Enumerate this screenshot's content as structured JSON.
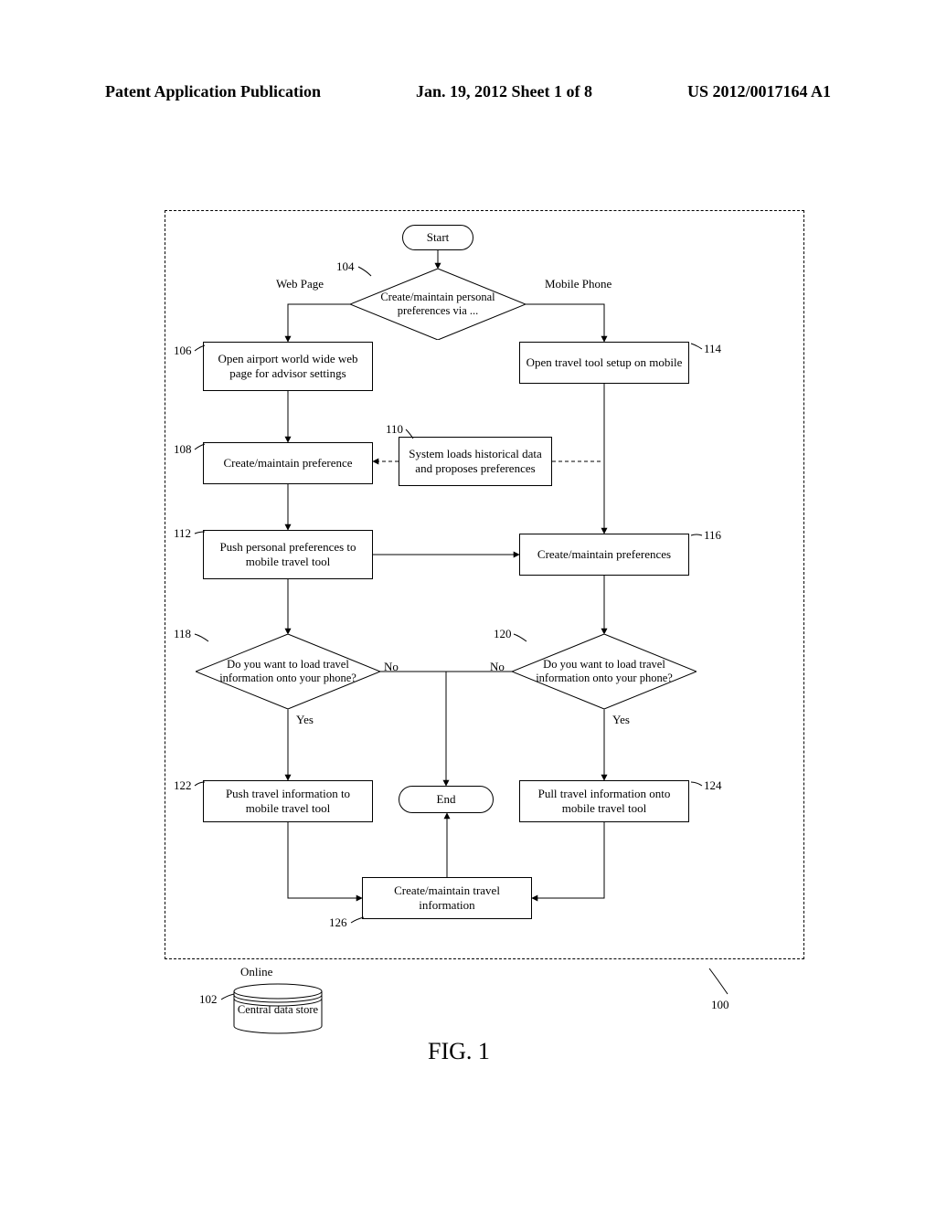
{
  "header": {
    "left": "Patent Application Publication",
    "center": "Jan. 19, 2012  Sheet 1 of 8",
    "right": "US 2012/0017164 A1"
  },
  "figure_label": "FIG. 1",
  "terminators": {
    "start": "Start",
    "end": "End"
  },
  "branch_labels": {
    "web": "Web Page",
    "mobile": "Mobile Phone",
    "yes": "Yes",
    "no": "No",
    "online": "Online"
  },
  "decisions": {
    "d104": "Create/maintain personal preferences via ...",
    "d118": "Do you want to load travel information onto your phone?",
    "d120": "Do you want to load travel information onto your phone?"
  },
  "processes": {
    "p106": "Open airport world wide web page for advisor settings",
    "p108": "Create/maintain preference",
    "p110": "System loads historical data and proposes preferences",
    "p112": "Push personal preferences to mobile travel tool",
    "p114": "Open travel tool setup on mobile",
    "p116": "Create/maintain preferences",
    "p122": "Push travel information to mobile travel tool",
    "p124": "Pull travel information onto mobile travel tool",
    "p126": "Create/maintain travel information"
  },
  "datastore": {
    "d102": "Central data store"
  },
  "refs": {
    "r100": "100",
    "r102": "102",
    "r104": "104",
    "r106": "106",
    "r108": "108",
    "r110": "110",
    "r112": "112",
    "r114": "114",
    "r116": "116",
    "r118": "118",
    "r120": "120",
    "r122": "122",
    "r124": "124",
    "r126": "126"
  }
}
